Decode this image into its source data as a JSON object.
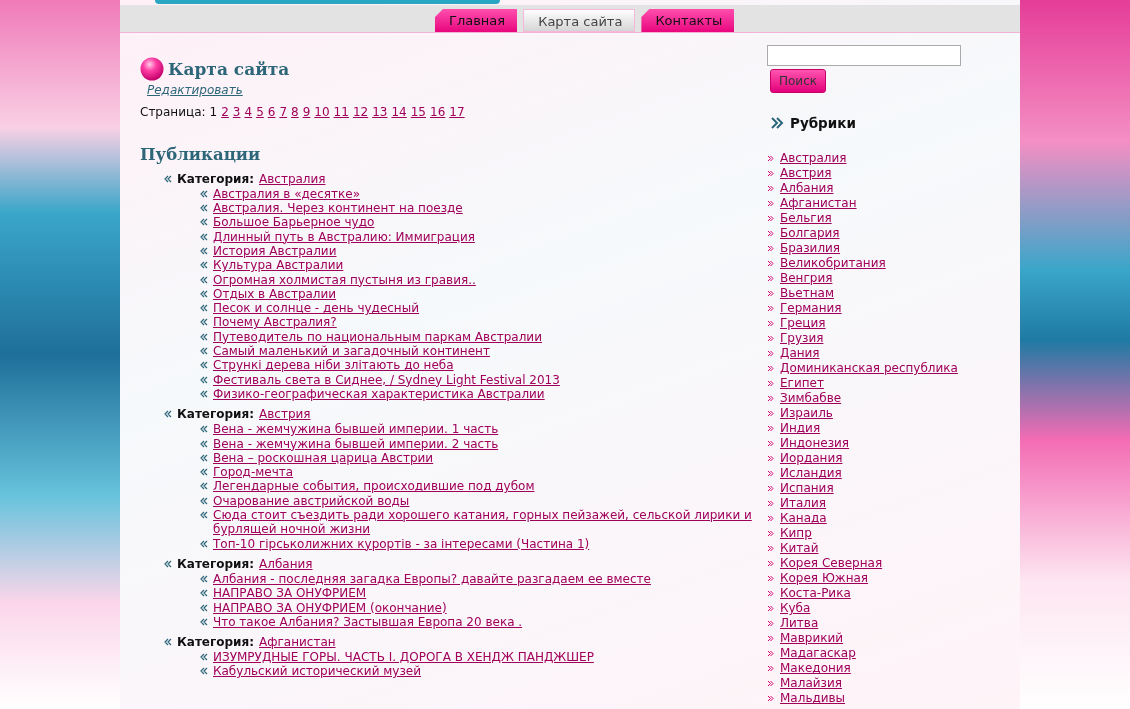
{
  "nav": {
    "tabs": [
      {
        "label": "Главная",
        "selected": false
      },
      {
        "label": "Карта сайта",
        "selected": true
      },
      {
        "label": "Контакты",
        "selected": false
      }
    ]
  },
  "page": {
    "title": "Карта сайта",
    "edit_link": "Редактировать",
    "pagination": {
      "label": "Страница:",
      "pages": [
        {
          "label": "1",
          "selected": true
        },
        {
          "label": "2",
          "selected": false
        },
        {
          "label": "3",
          "selected": false
        },
        {
          "label": "4",
          "selected": false
        },
        {
          "label": "5",
          "selected": false
        },
        {
          "label": "6",
          "selected": false
        },
        {
          "label": "7",
          "selected": false
        },
        {
          "label": "8",
          "selected": false
        },
        {
          "label": "9",
          "selected": false
        },
        {
          "label": "10",
          "selected": false
        },
        {
          "label": "11",
          "selected": false
        },
        {
          "label": "12",
          "selected": false
        },
        {
          "label": "13",
          "selected": false
        },
        {
          "label": "14",
          "selected": false
        },
        {
          "label": "15",
          "selected": false
        },
        {
          "label": "16",
          "selected": false
        },
        {
          "label": "17",
          "selected": false
        }
      ]
    }
  },
  "publications": {
    "heading": "Публикации",
    "categories": [
      {
        "label": "Категория:",
        "name": "Австралия",
        "posts": [
          "Австралия в «десятке»",
          "Австралия. Через континент на поезде",
          "Большое Барьерное чудо",
          "Длинный путь в Австралию: Иммиграция",
          "История Австралии",
          "Культура Австралии",
          "Огромная холмистая пустыня из гравия..",
          "Отдых в Австралии",
          "Песок и солнце - день чудесный",
          "Почему Австралия?",
          "Путеводитель по национальным паркам Австралии",
          "Самый маленький и загадочный континент",
          "Стрункі дерева ніби злітають до неба",
          "Фестиваль света в Сиднее, / Sydney Light Festival 2013",
          "Физико-географическая характеристика Австралии"
        ]
      },
      {
        "label": "Категория:",
        "name": "Австрия",
        "posts": [
          "Вена - жемчужина бывшей империи. 1 часть",
          "Вена - жемчужина бывшей империи. 2 часть",
          "Вена – роскошная царица Австрии",
          "Город-мечта",
          "Легендарные события, происходившие под дубом",
          "Очарование австрийской воды",
          "Сюда стоит съездить ради хорошего катания, горных пейзажей, сельской лирики и бурлящей ночной жизни",
          "Топ-10 гірськолижних курортів - за інтересами (Частина 1)"
        ]
      },
      {
        "label": "Категория:",
        "name": "Албания",
        "posts": [
          "Албания - последняя загадка Европы? давайте разгадаем ее вместе",
          "НАПРАВО ЗА ОНУФРИЕМ",
          "НАПРАВО ЗА ОНУФРИЕМ (окончание)",
          "Что такое Албания? Застывшая Европа 20 века ."
        ]
      },
      {
        "label": "Категория:",
        "name": "Афганистан",
        "posts": [
          "ИЗУМРУДНЫЕ ГОРЫ. ЧАСТЬ I. ДОРОГА В ХЕНДЖ ПАНДЖШЕР",
          "Кабульский исторический музей"
        ]
      }
    ]
  },
  "search": {
    "button": "Поиск"
  },
  "sidebar": {
    "heading": "Рубрики",
    "items": [
      "Австралия",
      "Австрия",
      "Албания",
      "Афганистан",
      "Бельгия",
      "Болгария",
      "Бразилия",
      "Великобритания",
      "Венгрия",
      "Вьетнам",
      "Германия",
      "Греция",
      "Грузия",
      "Дания",
      "Доминиканская республика",
      "Египет",
      "Зимбабве",
      "Израиль",
      "Индия",
      "Индонезия",
      "Иордания",
      "Исландия",
      "Испания",
      "Италия",
      "Канада",
      "Кипр",
      "Китай",
      "Корея Северная",
      "Корея Южная",
      "Коста-Рика",
      "Куба",
      "Литва",
      "Маврикий",
      "Мадагаскар",
      "Македония",
      "Малайзия",
      "Мальдивы"
    ]
  }
}
